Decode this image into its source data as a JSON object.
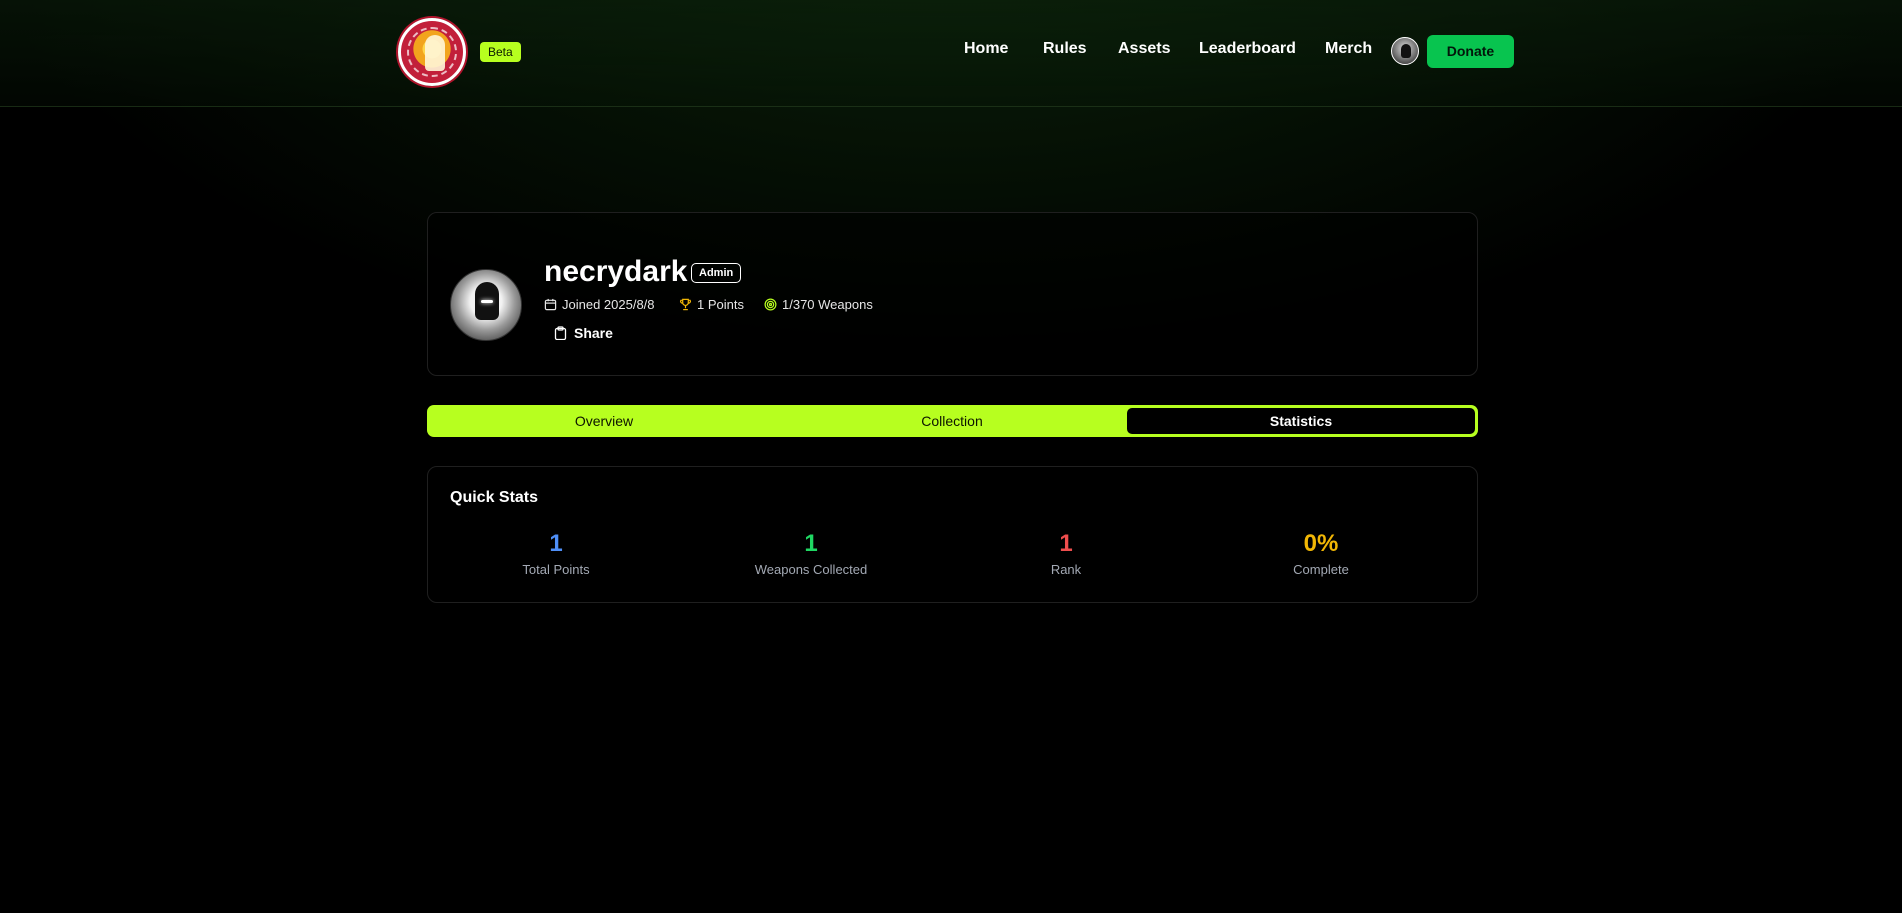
{
  "header": {
    "badge": "Beta",
    "nav": [
      "Home",
      "Rules",
      "Assets",
      "Leaderboard",
      "Merch"
    ],
    "donate_label": "Donate"
  },
  "profile": {
    "username": "necrydark",
    "role_badge": "Admin",
    "joined": "Joined 2025/8/8",
    "points": "1 Points",
    "weapons": "1/370 Weapons",
    "share_label": "Share",
    "icons": [
      "calendar-icon",
      "trophy-icon",
      "target-icon",
      "clipboard-icon"
    ]
  },
  "tabs": {
    "items": [
      "Overview",
      "Collection",
      "Statistics"
    ],
    "active": "Statistics"
  },
  "stats": {
    "title": "Quick Stats",
    "items": [
      {
        "value": "1",
        "label": "Total Points",
        "color": "#4f8ff7"
      },
      {
        "value": "1",
        "label": "Weapons Collected",
        "color": "#1fd863"
      },
      {
        "value": "1",
        "label": "Rank",
        "color": "#ef4e4e"
      },
      {
        "value": "0%",
        "label": "Complete",
        "color": "#f2b705"
      }
    ]
  },
  "colors": {
    "accent": "#b7ff1f",
    "donate": "#08c44f"
  }
}
